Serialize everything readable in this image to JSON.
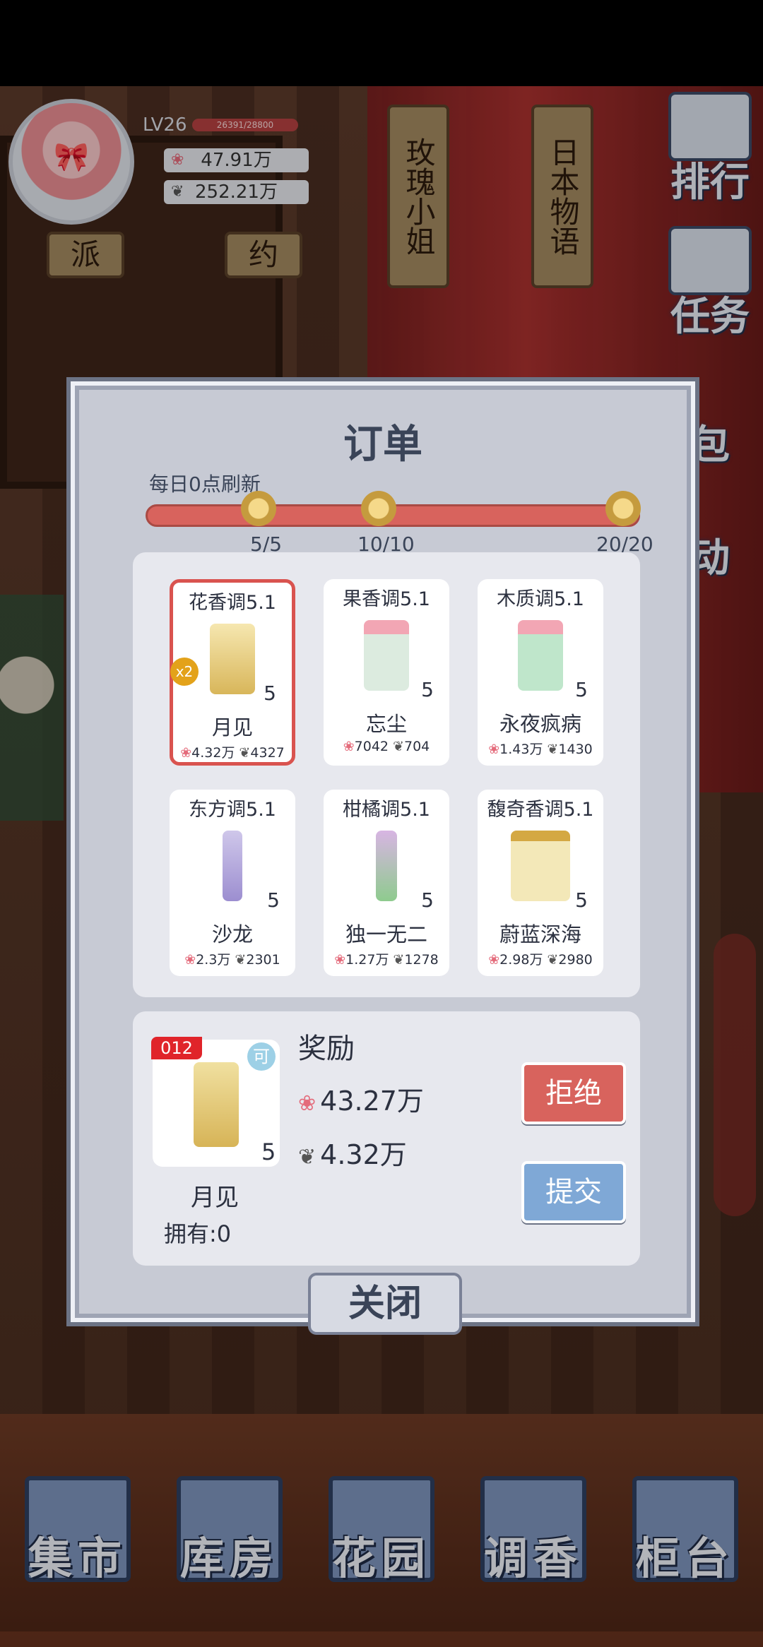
{
  "player": {
    "level": "LV26",
    "xp": "26391/28800",
    "petals": "47.91万",
    "leaves": "252.21万"
  },
  "tags": [
    "玫瑰小姐",
    "日本物语",
    "派",
    "约"
  ],
  "side_menu": [
    "排行",
    "任务",
    "包",
    "动"
  ],
  "order": {
    "title": "订单",
    "refresh_text": "每日0点刷新",
    "progress_percent": 100,
    "milestones": [
      "5/5",
      "10/10",
      "20/20"
    ],
    "cards": [
      {
        "category": "花香调5.1",
        "name": "月见",
        "qty": "5",
        "petal": "4.32万",
        "leaf": "4327",
        "selected": true,
        "bonus": "x2",
        "bottle": "#f0d98a"
      },
      {
        "category": "果香调5.1",
        "name": "忘尘",
        "qty": "5",
        "petal": "7042",
        "leaf": "704",
        "selected": false,
        "bonus": "",
        "bottle": "#d5e6d8"
      },
      {
        "category": "木质调5.1",
        "name": "永夜疯病",
        "qty": "5",
        "petal": "1.43万",
        "leaf": "1430",
        "selected": false,
        "bonus": "",
        "bottle": "#b9e3c6"
      },
      {
        "category": "东方调5.1",
        "name": "沙龙",
        "qty": "5",
        "petal": "2.3万",
        "leaf": "2301",
        "selected": false,
        "bonus": "",
        "bottle": "#b3a6d8"
      },
      {
        "category": "柑橘调5.1",
        "name": "独一无二",
        "qty": "5",
        "petal": "1.27万",
        "leaf": "1278",
        "selected": false,
        "bonus": "",
        "bottle": "#c8a3d8"
      },
      {
        "category": "馥奇香调5.1",
        "name": "蔚蓝深海",
        "qty": "5",
        "petal": "2.98万",
        "leaf": "2980",
        "selected": false,
        "bonus": "",
        "bottle": "#efe1a8"
      }
    ],
    "reward": {
      "badge": "012",
      "lock_icon": "可",
      "qty": "5",
      "name": "月见",
      "owned": "拥有:0",
      "title": "奖励",
      "petals": "43.27万",
      "leaves": "4.32万",
      "reject_label": "拒绝",
      "submit_label": "提交"
    },
    "close_label": "关闭"
  },
  "nav": [
    "集市",
    "库房",
    "花园",
    "调香",
    "柜台"
  ],
  "colors": {
    "accent_red": "#d8635d",
    "accent_blue": "#7fa8d6",
    "panel": "#c7cad4"
  }
}
